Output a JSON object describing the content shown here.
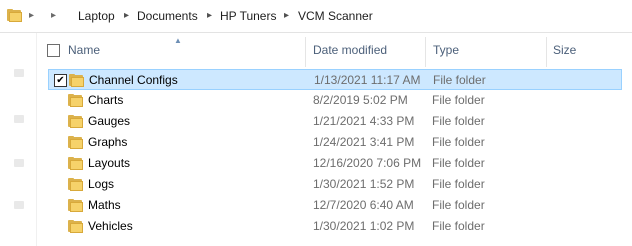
{
  "breadcrumb": {
    "items": [
      "Laptop",
      "Documents",
      "HP Tuners",
      "VCM Scanner"
    ]
  },
  "columns": {
    "name": "Name",
    "date_modified": "Date modified",
    "type": "Type",
    "size": "Size"
  },
  "files": [
    {
      "name": "Channel Configs",
      "date": "1/13/2021 11:17 AM",
      "type": "File folder",
      "selected": true
    },
    {
      "name": "Charts",
      "date": "8/2/2019 5:02 PM",
      "type": "File folder"
    },
    {
      "name": "Gauges",
      "date": "1/21/2021 4:33 PM",
      "type": "File folder"
    },
    {
      "name": "Graphs",
      "date": "1/24/2021 3:41 PM",
      "type": "File folder"
    },
    {
      "name": "Layouts",
      "date": "12/16/2020 7:06 PM",
      "type": "File folder"
    },
    {
      "name": "Logs",
      "date": "1/30/2021 1:52 PM",
      "type": "File folder"
    },
    {
      "name": "Maths",
      "date": "12/7/2020 6:40 AM",
      "type": "File folder"
    },
    {
      "name": "Vehicles",
      "date": "1/30/2021 1:02 PM",
      "type": "File folder"
    }
  ],
  "icons": {
    "folder": "folder-icon",
    "address_folder": "folder-icon",
    "chevron": "chevron-right-icon"
  },
  "colors": {
    "selection_bg": "#cde8ff",
    "selection_border": "#99d1ff",
    "header_text": "#4c607a",
    "folder": "#f6d26a"
  }
}
